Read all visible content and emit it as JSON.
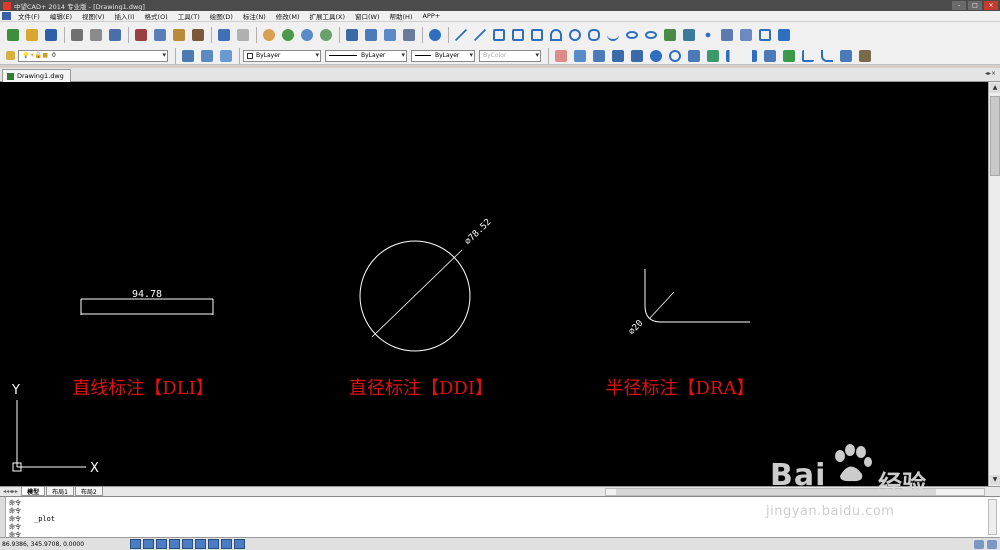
{
  "window": {
    "title": "中望CAD+ 2014 专业版 - [Drawing1.dwg]",
    "buttons": [
      "-",
      "□",
      "×"
    ]
  },
  "menu": {
    "items": [
      "文件(F)",
      "编辑(E)",
      "视图(V)",
      "插入(I)",
      "格式(O)",
      "工具(T)",
      "绘图(D)",
      "标注(N)",
      "修改(M)",
      "扩展工具(X)",
      "窗口(W)",
      "帮助(H)",
      "APP+"
    ]
  },
  "layer_toolbar": {
    "layer_value": "0",
    "color_value": "ByLayer",
    "linetype_value": "ByLayer",
    "lineweight_value": "ByLayer",
    "plotstyle_value": "ByColor"
  },
  "document": {
    "tab_label": "Drawing1.dwg",
    "nav": "◂▸×"
  },
  "drawing": {
    "linear_dim": "94.78",
    "diameter_dim": "⌀78.52",
    "radius_dim": "⌀20",
    "labels": {
      "linear": "直线标注【DLI】",
      "diameter": "直径标注【DDI】",
      "radius": "半径标注【DRA】"
    },
    "ucs_x": "X",
    "ucs_y": "Y",
    "colors": {
      "background": "#000000",
      "geometry": "#ffffff",
      "label": "#e01010"
    }
  },
  "layout_tabs": [
    "模型",
    "布局1",
    "布局2"
  ],
  "command": {
    "history": [
      "命令",
      "命令",
      "命令",
      "命令",
      "命令"
    ],
    "current": "_plot"
  },
  "status": {
    "coords": "86.9386, 345.9708, 0.0000"
  },
  "watermark": {
    "brand": "Bai",
    "brand_word": "经验",
    "url": "jingyan.baidu.com"
  }
}
